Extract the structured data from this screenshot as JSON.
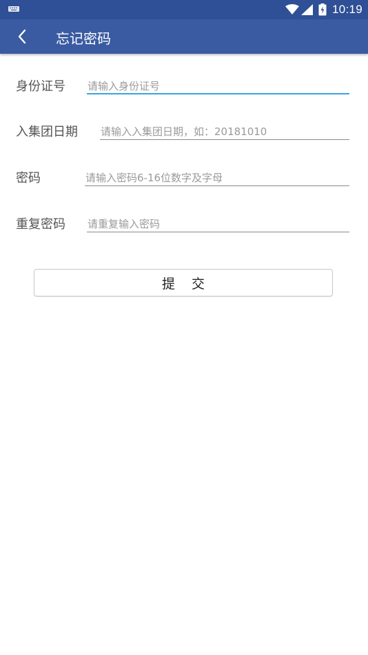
{
  "status_bar": {
    "time": "10:19",
    "icons": [
      "keyboard-icon",
      "wifi-icon",
      "cell-signal-icon",
      "battery-charging-icon"
    ]
  },
  "app_bar": {
    "title": "忘记密码",
    "back_icon": "chevron-left-icon",
    "background": "#3a5ba1"
  },
  "form": {
    "id_number": {
      "label": "身份证号",
      "value": "",
      "placeholder": "请输入身份证号"
    },
    "join_date": {
      "label": "入集团日期",
      "value": "",
      "placeholder": "请输入入集团日期，如：20181010"
    },
    "password": {
      "label": "密码",
      "value": "",
      "placeholder": "请输入密码6-16位数字及字母"
    },
    "confirm_password": {
      "label": "重复密码",
      "value": "",
      "placeholder": "请重复输入密码"
    }
  },
  "submit": {
    "label": "提交"
  },
  "colors": {
    "status_bar": "#2f4f96",
    "active_underline": "#3aa3e3"
  }
}
